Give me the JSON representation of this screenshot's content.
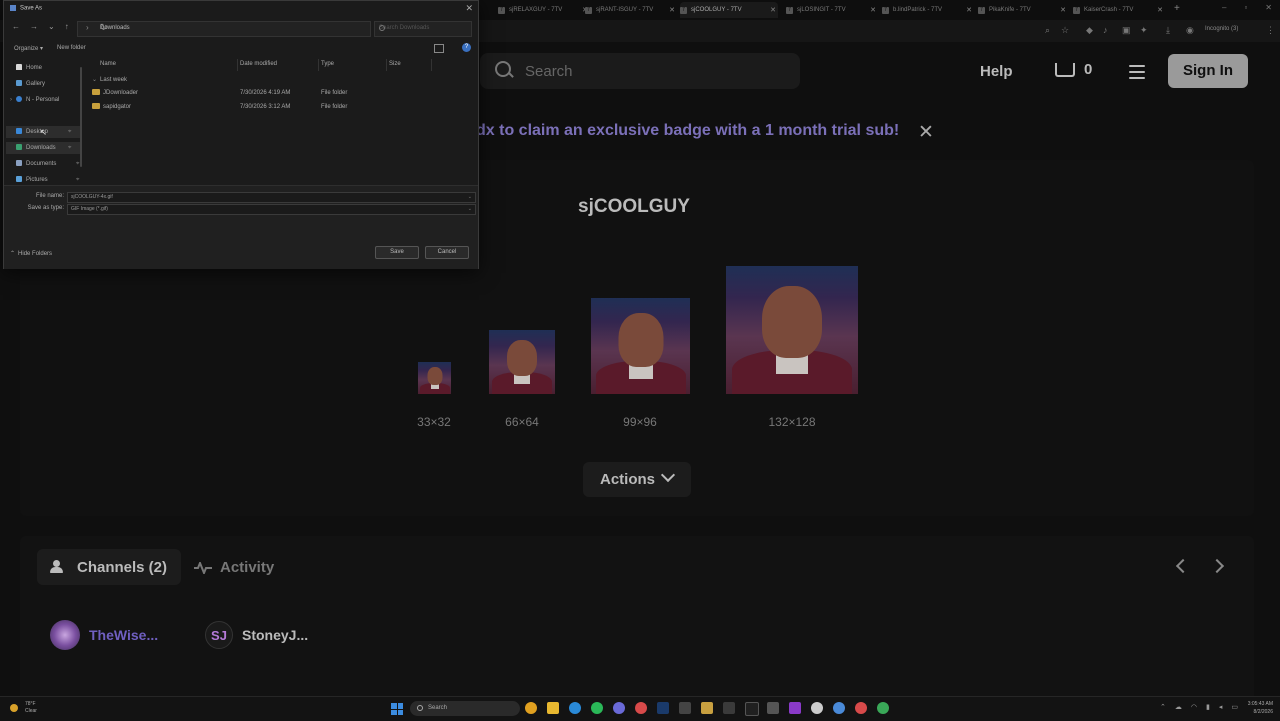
{
  "browser": {
    "tabs": [
      {
        "label": "sjRELAXGUY - 7TV",
        "active": false
      },
      {
        "label": "sjRANT-ISGUY - 7TV",
        "active": false
      },
      {
        "label": "sjCOOLGUY - 7TV",
        "active": true
      },
      {
        "label": "sjLOSINGIT - 7TV",
        "active": false
      },
      {
        "label": "b.lindPatrick - 7TV",
        "active": false
      },
      {
        "label": "PikaKnife - 7TV",
        "active": false
      },
      {
        "label": "KaiserCrash - 7TV",
        "active": false
      }
    ],
    "incognito_label": "Incognito (3)"
  },
  "site": {
    "search_placeholder": "Search",
    "help_label": "Help",
    "cart_count": "0",
    "signin_label": "Sign In",
    "promo_text": "dx to claim an exclusive badge with a 1 month trial sub!"
  },
  "emote": {
    "name": "sjCOOLGUY",
    "sizes": [
      {
        "label": "33×32"
      },
      {
        "label": "66×64"
      },
      {
        "label": "99×96"
      },
      {
        "label": "132×128"
      }
    ],
    "actions_label": "Actions"
  },
  "bottom": {
    "channels_tab": "Channels (2)",
    "activity_tab": "Activity",
    "channels": [
      {
        "name": "TheWise...",
        "color": "#6f5fc0"
      },
      {
        "name": "StoneyJ...",
        "color": "#bbbbbb"
      }
    ]
  },
  "dialog": {
    "title": "Save As",
    "address": "Downloads",
    "search_placeholder": "Search Downloads",
    "organize_label": "Organize ▾",
    "new_folder_label": "New folder",
    "sidebar": [
      {
        "label": "Home",
        "icon": "home-icon",
        "pinned": false,
        "selected": false
      },
      {
        "label": "Gallery",
        "icon": "gallery-icon",
        "pinned": false,
        "selected": false
      },
      {
        "label": "N - Personal",
        "icon": "cloud-icon",
        "pinned": false,
        "selected": false
      },
      {
        "label": "Desktop",
        "icon": "desktop-icon",
        "pinned": true,
        "selected": true
      },
      {
        "label": "Downloads",
        "icon": "download-icon",
        "pinned": true,
        "selected": true
      },
      {
        "label": "Documents",
        "icon": "document-icon",
        "pinned": true,
        "selected": false
      },
      {
        "label": "Pictures",
        "icon": "picture-icon",
        "pinned": true,
        "selected": false
      }
    ],
    "columns": [
      "Name",
      "Date modified",
      "Type",
      "Size"
    ],
    "group_label": "Last week",
    "files": [
      {
        "name": "JDownloader",
        "date": "7/30/2026 4:19 AM",
        "type": "File folder"
      },
      {
        "name": "sapidgator",
        "date": "7/30/2026 3:12 AM",
        "type": "File folder"
      }
    ],
    "file_name_label": "File name:",
    "file_name_value": "sjCOOLGUY-4x.gif",
    "save_type_label": "Save as type:",
    "save_type_value": "GIF Image (*.gif)",
    "hide_folders_label": "Hide Folders",
    "save_label": "Save",
    "cancel_label": "Cancel"
  },
  "taskbar": {
    "weather_temp": "78°F",
    "weather_desc": "Clear",
    "search_label": "Search",
    "time": "3:05:43 AM",
    "date": "8/2/2026"
  }
}
